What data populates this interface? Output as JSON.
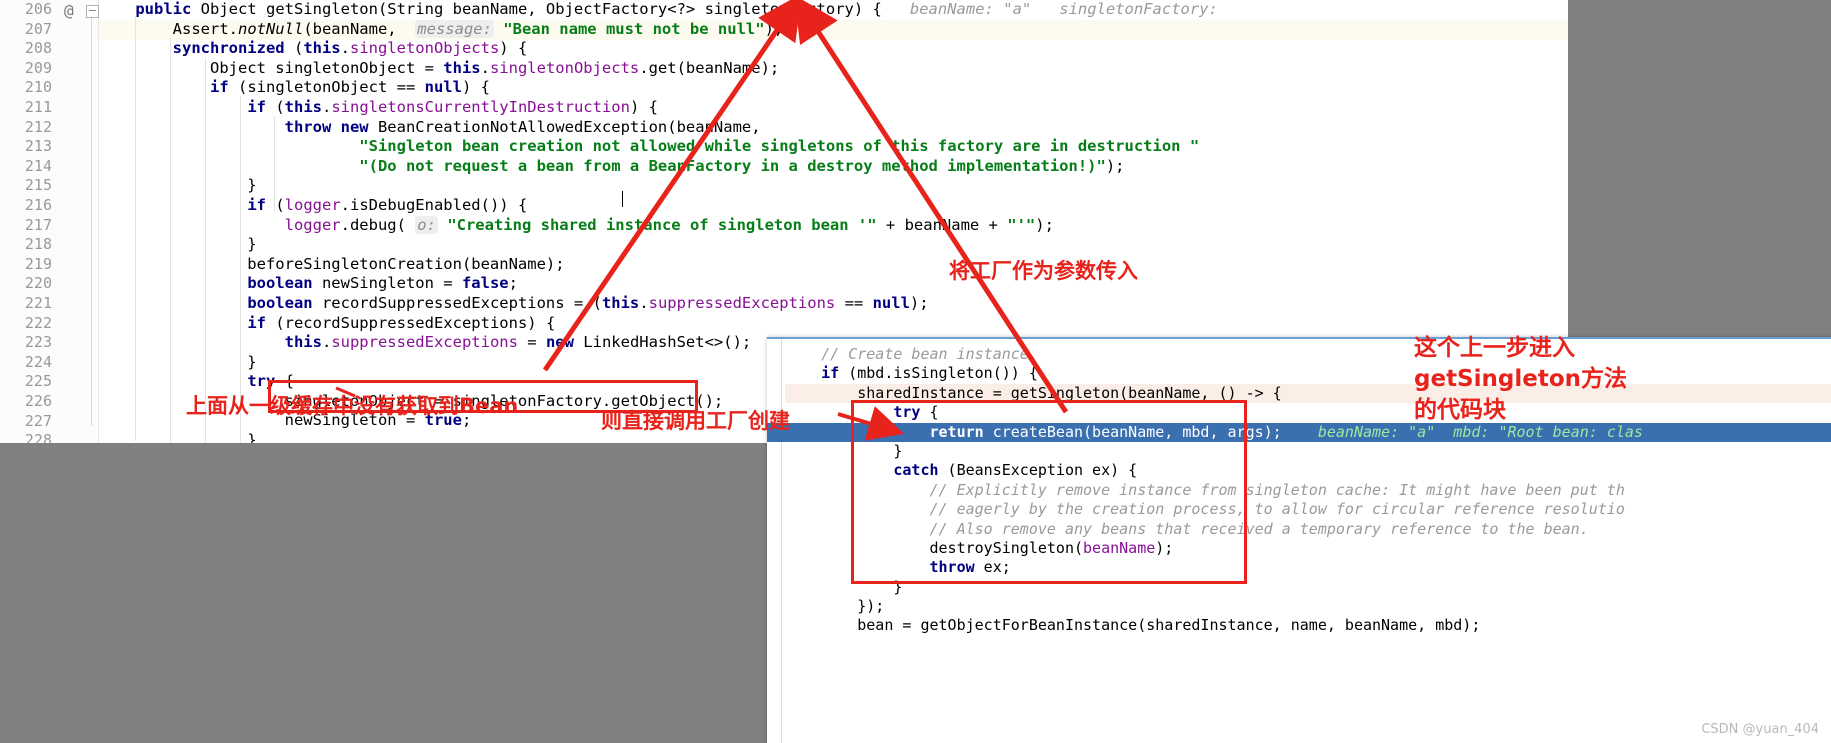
{
  "editor": {
    "first_line_number": 206,
    "current_line_number": 207,
    "at_icon": "@",
    "lines": [
      {
        "n": 206,
        "html": "    <span class=\"kw\">public</span> Object getSingleton(String beanName, ObjectFactory&lt;?&gt; singletonFactory) {   <span class=\"hint\">beanName:</span> <span class=\"hint\">\"a\"</span>   <span class=\"hint\">singletonFactory:</span>"
      },
      {
        "n": 207,
        "html": "        Assert.<span class=\"ital\">notNull</span>(beanName,  <span class=\"hintbg\">message:</span> <span class=\"str\">\"Bean name must not be null\"</span>);"
      },
      {
        "n": 208,
        "html": "        <span class=\"kw\">synchronized</span> (<span class=\"kw\">this</span>.<span class=\"fld\">singletonObjects</span>) {"
      },
      {
        "n": 209,
        "html": "            Object singletonObject = <span class=\"kw\">this</span>.<span class=\"fld\">singletonObjects</span>.get(beanName);"
      },
      {
        "n": 210,
        "html": "            <span class=\"kw\">if</span> (singletonObject == <span class=\"kw\">null</span>) {"
      },
      {
        "n": 211,
        "html": "                <span class=\"kw\">if</span> (<span class=\"kw\">this</span>.<span class=\"fld\">singletonsCurrentlyInDestruction</span>) {"
      },
      {
        "n": 212,
        "html": "                    <span class=\"kw\">throw new</span> BeanCreationNotAllowedException(beanName,"
      },
      {
        "n": 213,
        "html": "                            <span class=\"str\">\"Singleton bean creation not allowed while singletons of this factory are in destruction \"</span>"
      },
      {
        "n": 214,
        "html": "                            <span class=\"str\">\"(Do not request a bean from a BeanFactory in a destroy method implementation!)\"</span>);"
      },
      {
        "n": 215,
        "html": "                }"
      },
      {
        "n": 216,
        "html": "                <span class=\"kw\">if</span> (<span class=\"fld\">logger</span>.isDebugEnabled()) {"
      },
      {
        "n": 217,
        "html": "                    <span class=\"fld\">logger</span>.debug( <span class=\"hintbg\">o:</span> <span class=\"str\">\"Creating shared instance of singleton bean '\"</span> + beanName + <span class=\"str\">\"'\"</span>);"
      },
      {
        "n": 218,
        "html": "                }"
      },
      {
        "n": 219,
        "html": "                beforeSingletonCreation(beanName);"
      },
      {
        "n": 220,
        "html": "                <span class=\"kw\">boolean</span> newSingleton = <span class=\"kw\">false</span>;"
      },
      {
        "n": 221,
        "html": "                <span class=\"kw\">boolean</span> recordSuppressedExceptions = (<span class=\"kw\">this</span>.<span class=\"fld\">suppressedExceptions</span> == <span class=\"kw\">null</span>);"
      },
      {
        "n": 222,
        "html": "                <span class=\"kw\">if</span> (recordSuppressedExceptions) {"
      },
      {
        "n": 223,
        "html": "                    <span class=\"kw\">this</span>.<span class=\"fld\">suppressedExceptions</span> = <span class=\"kw\">new</span> LinkedHashSet&lt;&gt;();"
      },
      {
        "n": 224,
        "html": "                }"
      },
      {
        "n": 225,
        "html": "                <span class=\"kw\">try</span> {"
      },
      {
        "n": 226,
        "html": "                    singletonObject = singletonFactory.getObject();"
      },
      {
        "n": 227,
        "html": "                    newSingleton = <span class=\"kw\">true</span>;"
      },
      {
        "n": 228,
        "html": "                }"
      }
    ]
  },
  "popup": {
    "lines": [
      {
        "html": "    <span class=\"hint\">// Create bean instance.</span>",
        "style": "normal"
      },
      {
        "html": "    <span class=\"kw\">if</span> (mbd.isSingleton()) {",
        "style": "normal"
      },
      {
        "html": "        sharedInstance = getSingleton(beanName, () -&gt; {",
        "style": "hl"
      },
      {
        "html": "            <span class=\"kw\">try</span> {",
        "style": "normal"
      },
      {
        "html": "                <span class=\"kw\">return</span> createBean(beanName, mbd, args);    <span class=\"exechint\">beanName: \"a\"  mbd: \"Root bean: clas</span>",
        "style": "exec"
      },
      {
        "html": "            }",
        "style": "normal"
      },
      {
        "html": "            <span class=\"kw\">catch</span> (BeansException ex) {",
        "style": "normal"
      },
      {
        "html": "                <span class=\"hint\">// Explicitly remove instance from singleton cache: It might have been put th</span>",
        "style": "normal"
      },
      {
        "html": "                <span class=\"hint\">// eagerly by the creation process, to allow for circular reference resolutio</span>",
        "style": "normal"
      },
      {
        "html": "                <span class=\"hint\">// Also remove any beans that received a temporary reference to the bean.</span>",
        "style": "normal"
      },
      {
        "html": "                destroySingleton(<span class=\"fld\">beanName</span>);",
        "style": "normal"
      },
      {
        "html": "                <span class=\"kw\">throw</span> ex;",
        "style": "normal"
      },
      {
        "html": "            }",
        "style": "normal"
      },
      {
        "html": "        });",
        "style": "normal"
      },
      {
        "html": "        bean = getObjectForBeanInstance(sharedInstance, name, beanName, mbd);",
        "style": "normal"
      }
    ]
  },
  "annotations": {
    "note_left": "上面从一级缓存中没有获取到Bean",
    "note_bottom": "则直接调用工厂创建",
    "note_top_right": "将工厂作为参数传入",
    "note_far_right_line1": "这个上一步进入",
    "note_far_right_line2": "getSingleton方法",
    "note_far_right_line3": "的代码块"
  },
  "watermark": "CSDN @yuan_404",
  "colors": {
    "annotation_red": "#e8231c",
    "keyword_blue": "#000080",
    "field_purple": "#871094",
    "string_green": "#067d17",
    "exec_highlight": "#3a6fb0",
    "background_gray": "#808080"
  }
}
